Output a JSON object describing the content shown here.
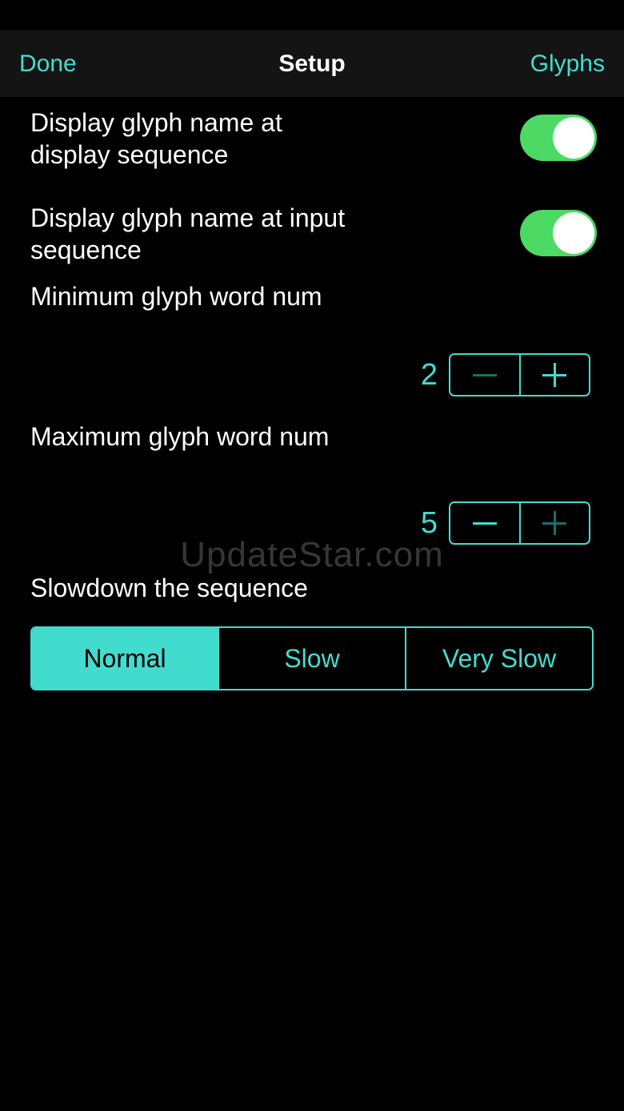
{
  "nav": {
    "left_label": "Done",
    "title": "Setup",
    "right_label": "Glyphs"
  },
  "settings": {
    "display_seq": {
      "line1": "Display glyph name at",
      "line2": "display sequence",
      "on": true
    },
    "input_seq": {
      "line1": "Display glyph name at input",
      "line2": "sequence",
      "on": true
    },
    "min_word": {
      "label": "Minimum glyph word num",
      "value": "2"
    },
    "max_word": {
      "label": "Maximum glyph word num",
      "value": "5"
    },
    "slowdown": {
      "label": "Slowdown the sequence",
      "options": [
        "Normal",
        "Slow",
        "Very Slow"
      ],
      "selected": "Normal"
    }
  },
  "watermark": "UpdateStar.com",
  "colors": {
    "accent": "#42dccf",
    "toggle_on": "#4cd964",
    "background": "#000000",
    "nav_background": "#141414"
  }
}
